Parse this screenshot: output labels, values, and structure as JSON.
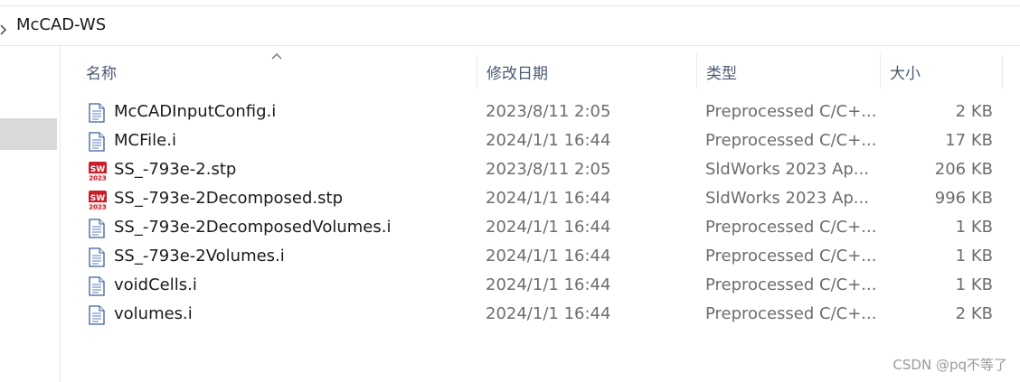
{
  "address_bar": {
    "folder": "McCAD-WS"
  },
  "columns": {
    "name": "名称",
    "date": "修改日期",
    "type": "类型",
    "size": "大小"
  },
  "files": [
    {
      "name": "McCADInputConfig.i",
      "date": "2023/8/11 2:05",
      "type": "Preprocessed C/C+...",
      "size": "2 KB",
      "icon": "text-file-icon"
    },
    {
      "name": "MCFile.i",
      "date": "2024/1/1 16:44",
      "type": "Preprocessed C/C+...",
      "size": "17 KB",
      "icon": "text-file-icon"
    },
    {
      "name": "SS_-793e-2.stp",
      "date": "2023/8/11 2:05",
      "type": "SldWorks 2023 Ap...",
      "size": "206 KB",
      "icon": "solidworks-file-icon"
    },
    {
      "name": "SS_-793e-2Decomposed.stp",
      "date": "2024/1/1 16:44",
      "type": "SldWorks 2023 Ap...",
      "size": "996 KB",
      "icon": "solidworks-file-icon"
    },
    {
      "name": "SS_-793e-2DecomposedVolumes.i",
      "date": "2024/1/1 16:44",
      "type": "Preprocessed C/C+...",
      "size": "1 KB",
      "icon": "text-file-icon"
    },
    {
      "name": "SS_-793e-2Volumes.i",
      "date": "2024/1/1 16:44",
      "type": "Preprocessed C/C+...",
      "size": "1 KB",
      "icon": "text-file-icon"
    },
    {
      "name": "voidCells.i",
      "date": "2024/1/1 16:44",
      "type": "Preprocessed C/C+...",
      "size": "1 KB",
      "icon": "text-file-icon"
    },
    {
      "name": "volumes.i",
      "date": "2024/1/1 16:44",
      "type": "Preprocessed C/C+...",
      "size": "2 KB",
      "icon": "text-file-icon"
    }
  ],
  "solidworks_icon_label": {
    "top": "SW",
    "bottom": "2023"
  },
  "watermark": "CSDN @pq不等了",
  "colors": {
    "header_text": "#4a5a73",
    "sw_red": "#c8202a",
    "selection": "#d9d9d9"
  }
}
